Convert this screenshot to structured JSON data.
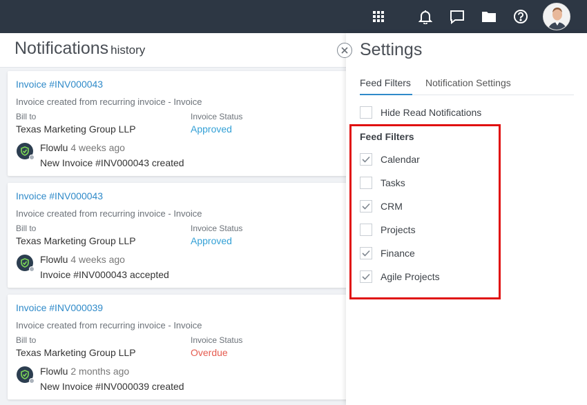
{
  "topbar": {
    "icons": [
      "apps-grid-icon",
      "bell-icon",
      "chat-icon",
      "folder-icon",
      "help-icon"
    ]
  },
  "notifications": {
    "title": "Notifications",
    "title_suffix": "history",
    "cards": [
      {
        "invoice": "Invoice #INV000043",
        "subtitle": "Invoice created from recurring invoice - Invoice",
        "bill_to_label": "Bill to",
        "bill_to": "Texas Marketing Group LLP",
        "status_label": "Invoice Status",
        "status": "Approved",
        "author": "Flowlu",
        "time": "4 weeks ago",
        "message": "New Invoice #INV000043 created"
      },
      {
        "invoice": "Invoice #INV000043",
        "subtitle": "Invoice created from recurring invoice - Invoice",
        "bill_to_label": "Bill to",
        "bill_to": "Texas Marketing Group LLP",
        "status_label": "Invoice Status",
        "status": "Approved",
        "author": "Flowlu",
        "time": "4 weeks ago",
        "message": "Invoice #INV000043 accepted"
      },
      {
        "invoice": "Invoice #INV000039",
        "subtitle": "Invoice created from recurring invoice - Invoice",
        "bill_to_label": "Bill to",
        "bill_to": "Texas Marketing Group LLP",
        "status_label": "Invoice Status",
        "status": "Overdue",
        "author": "Flowlu",
        "time": "2 months ago",
        "message": "New Invoice #INV000039 created"
      }
    ]
  },
  "settings": {
    "title": "Settings",
    "tabs": [
      {
        "label": "Feed Filters",
        "active": true
      },
      {
        "label": "Notification Settings",
        "active": false
      }
    ],
    "hide_read": {
      "label": "Hide Read Notifications",
      "checked": false
    },
    "feed_filters_title": "Feed Filters",
    "filters": [
      {
        "label": "Calendar",
        "checked": true
      },
      {
        "label": "Tasks",
        "checked": false
      },
      {
        "label": "CRM",
        "checked": true
      },
      {
        "label": "Projects",
        "checked": false
      },
      {
        "label": "Finance",
        "checked": true
      },
      {
        "label": "Agile Projects",
        "checked": true
      }
    ]
  },
  "colors": {
    "topbar": "#2d3744",
    "link": "#2f8ac9",
    "approved": "#33a0d6",
    "overdue": "#e55b4f",
    "highlight": "#e01010"
  }
}
